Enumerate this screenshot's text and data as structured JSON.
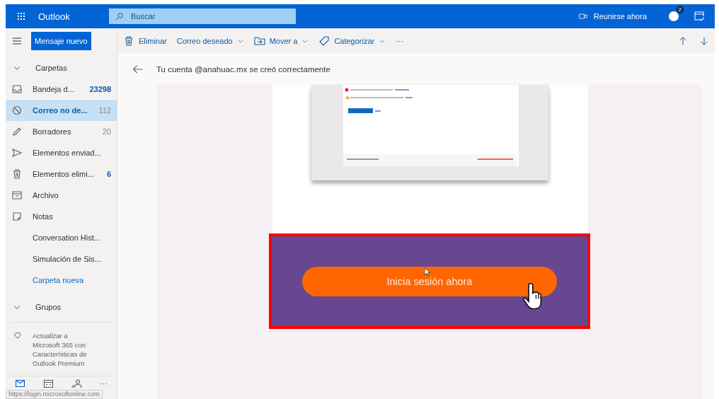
{
  "app": {
    "name": "Outlook"
  },
  "search": {
    "placeholder": "Buscar"
  },
  "header_actions": {
    "meet_now": "Reunirse ahora",
    "skype_badge": "2"
  },
  "new_message": "Mensaje nuevo",
  "toolbar": [
    {
      "kind": "delete",
      "label": "Eliminar",
      "dropdown": false
    },
    {
      "kind": "junk",
      "label": "Correo deseado",
      "dropdown": true
    },
    {
      "kind": "move",
      "label": "Mover a",
      "dropdown": true
    },
    {
      "kind": "categorize",
      "label": "Categorizar",
      "dropdown": true
    },
    {
      "kind": "more",
      "label": "···",
      "dropdown": false
    }
  ],
  "sidebar": {
    "folders_header": {
      "label": "Carpetas",
      "expanded": true
    },
    "items": [
      {
        "kind": "inbox",
        "label": "Bandeja d...",
        "count": "23298",
        "unread": true,
        "selected": false
      },
      {
        "kind": "junk",
        "label": "Correo no de...",
        "count": "112",
        "unread": false,
        "selected": true
      },
      {
        "kind": "drafts",
        "label": "Borradores",
        "count": "20",
        "unread": false,
        "selected": false
      },
      {
        "kind": "sent",
        "label": "Elementos enviad...",
        "selected": false
      },
      {
        "kind": "deleted",
        "label": "Elementos elimi...",
        "count": "6",
        "unread": true,
        "selected": false
      },
      {
        "kind": "archive",
        "label": "Archivo",
        "selected": false
      },
      {
        "kind": "notes",
        "label": "Notas",
        "selected": false
      },
      {
        "kind": "folder",
        "label": "Conversation Hist...",
        "selected": false
      },
      {
        "kind": "folder",
        "label": "Simulación de Sis...",
        "selected": false
      },
      {
        "kind": "link",
        "label": "Carpeta nueva",
        "selected": false
      }
    ],
    "groups_header": {
      "label": "Grupos",
      "expanded": true
    },
    "upgrade": "Actualizar a Microsoft 365 con Características de Outlook Premium",
    "bottom_nav": [
      {
        "kind": "mail",
        "selected": true
      },
      {
        "kind": "calendar",
        "selected": false
      },
      {
        "kind": "people",
        "selected": false
      },
      {
        "kind": "more",
        "label": "···",
        "selected": false
      }
    ]
  },
  "status_url": "https://login.microsoftonline.com",
  "message": {
    "subject": "Tu cuenta @anahuac.mx se creó correctamente",
    "cta": "Inicia sesión ahora"
  }
}
